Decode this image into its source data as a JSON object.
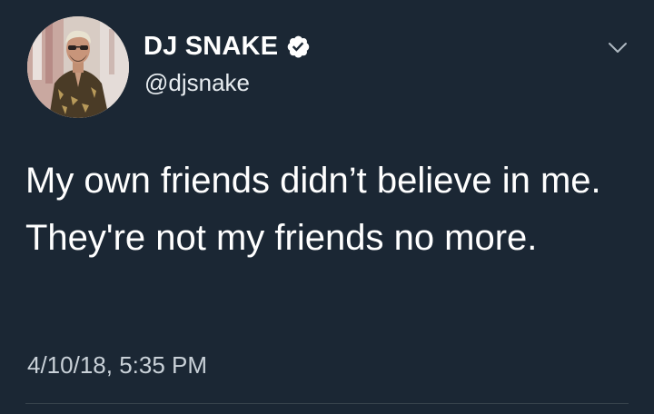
{
  "tweet": {
    "display_name": "DJ SNAKE",
    "handle": "@djsnake",
    "text": "My own friends didn’t believe in me. They're not my friends no more.",
    "timestamp": "4/10/18, 5:35 PM",
    "verified": true,
    "menu_icon": "chevron-down-icon",
    "verified_icon": "verified-badge-icon"
  },
  "colors": {
    "background": "#1b2734",
    "text": "#ffffff",
    "secondary_text": "#c9d1d8",
    "divider": "#38444d"
  }
}
